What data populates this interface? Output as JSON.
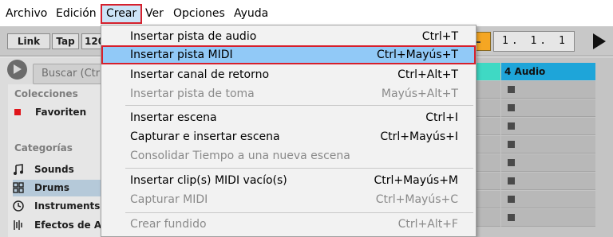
{
  "menubar": {
    "items": [
      {
        "label": "Archivo"
      },
      {
        "label": "Edición"
      },
      {
        "label": "Crear"
      },
      {
        "label": "Ver"
      },
      {
        "label": "Opciones"
      },
      {
        "label": "Ayuda"
      }
    ]
  },
  "toolbar": {
    "link_label": "Link",
    "tap_label": "Tap",
    "tempo_partial": "120",
    "position": "1. 1. 1"
  },
  "browser": {
    "search_placeholder": "Buscar (Ctrl",
    "collections_heading": "Colecciones",
    "favorites_label": "Favoriten",
    "favorites_color": "#e0151b",
    "categories_heading": "Categorías",
    "categories": [
      {
        "label": "Sounds",
        "icon": "music-note-icon"
      },
      {
        "label": "Drums",
        "icon": "drum-grid-icon",
        "selected": true
      },
      {
        "label": "Instruments",
        "icon": "clock-icon"
      },
      {
        "label": "Efectos de Au",
        "icon": "audio-effect-icon"
      }
    ],
    "selected_color": "#b5c9d9"
  },
  "tracks": {
    "header_label": "4 Audio",
    "header_color": "#1ea5d9",
    "prev_track_color": "#3fd9c4"
  },
  "create_menu": {
    "highlight_color": "#91c9f7",
    "items": [
      {
        "label": "Insertar pista de audio",
        "shortcut": "Ctrl+T",
        "enabled": true
      },
      {
        "label": "Insertar pista MIDI",
        "shortcut": "Ctrl+Mayús+T",
        "enabled": true,
        "highlighted": true
      },
      {
        "label": "Insertar canal de retorno",
        "shortcut": "Ctrl+Alt+T",
        "enabled": true
      },
      {
        "label": "Insertar pista de toma",
        "shortcut": "Mayús+Alt+T",
        "enabled": false
      },
      {
        "label": "Insertar escena",
        "shortcut": "Ctrl+I",
        "enabled": true
      },
      {
        "label": "Capturar e insertar escena",
        "shortcut": "Ctrl+Mayús+I",
        "enabled": true
      },
      {
        "label": "Consolidar Tiempo a una nueva escena",
        "shortcut": "",
        "enabled": false
      },
      {
        "label": "Insertar clip(s) MIDI vacío(s)",
        "shortcut": "Ctrl+Mayús+M",
        "enabled": true
      },
      {
        "label": "Capturar MIDI",
        "shortcut": "Ctrl+Mayús+C",
        "enabled": false
      },
      {
        "label": "Crear fundido",
        "shortcut": "Ctrl+Alt+F",
        "enabled": false
      }
    ]
  }
}
